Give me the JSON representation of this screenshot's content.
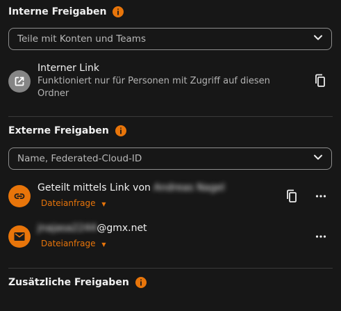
{
  "colors": {
    "accent": "#e8750a",
    "background": "#171717",
    "muted_avatar": "#858585"
  },
  "internal": {
    "heading": "Interne Freigaben",
    "search_placeholder": "Teile mit Konten und Teams",
    "link": {
      "title": "Interner Link",
      "description": "Funktioniert nur für Personen mit Zugriff auf diesen Ordner",
      "icon": "external-link-icon"
    }
  },
  "external": {
    "heading": "Externe Freigaben",
    "search_placeholder": "Name, Federated-Cloud-ID",
    "items": [
      {
        "title_prefix": "Geteilt mittels Link von",
        "title_redacted": "Andreas Nagel",
        "permission": "Dateianfrage",
        "icon": "link-icon"
      },
      {
        "title_redacted": "jnajasa2244",
        "title_suffix": "@gmx.net",
        "permission": "Dateianfrage",
        "icon": "mail-icon"
      }
    ]
  },
  "additional": {
    "heading": "Zusätzliche Freigaben"
  }
}
